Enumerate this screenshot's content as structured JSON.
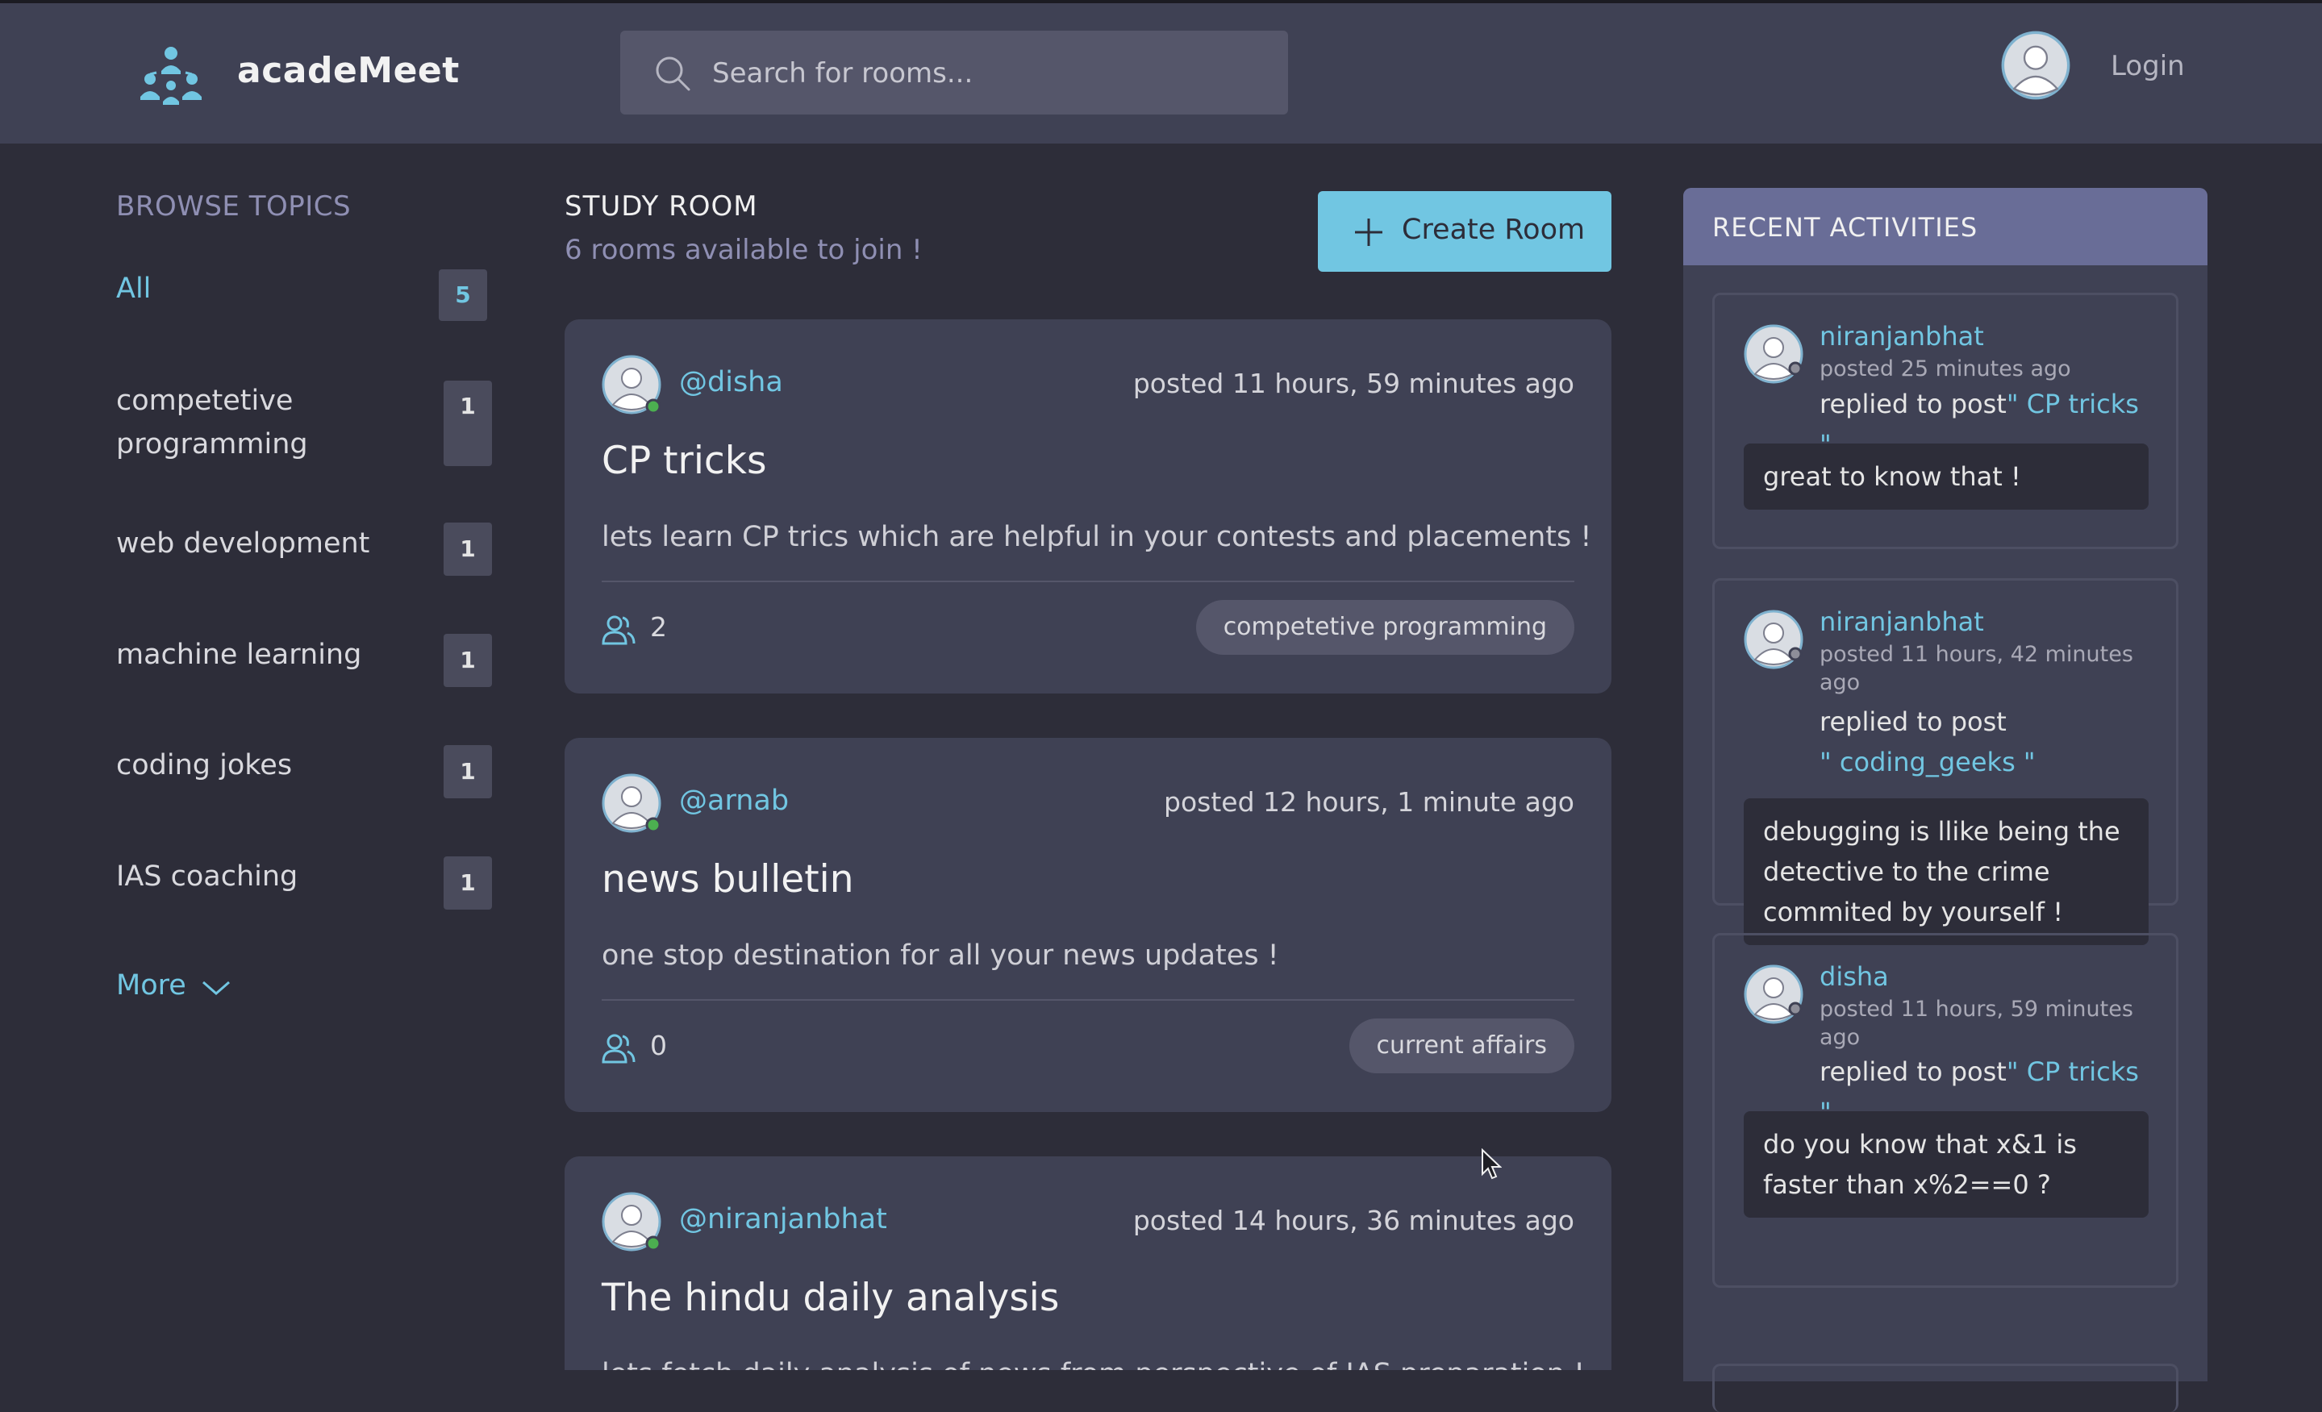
{
  "app": {
    "brand": "acadeMeet",
    "search_placeholder": "Search for rooms...",
    "login_label": "Login"
  },
  "sidebar": {
    "title": "BROWSE TOPICS",
    "topics": [
      {
        "label": "All",
        "count": "5"
      },
      {
        "label": "competetive programming",
        "count": "1"
      },
      {
        "label": "web development",
        "count": "1"
      },
      {
        "label": "machine learning",
        "count": "1"
      },
      {
        "label": "coding jokes",
        "count": "1"
      },
      {
        "label": "IAS coaching",
        "count": "1"
      }
    ],
    "more_label": "More"
  },
  "feed": {
    "title": "STUDY ROOM",
    "subtitle": "6 rooms available to join !",
    "create_label": "Create Room",
    "rooms": [
      {
        "host": "@disha",
        "posted": "posted 11 hours, 59 minutes ago",
        "title": "CP tricks",
        "description": "lets learn CP trics which are helpful in your contests and placements !",
        "participants": "2",
        "topic": "competetive programming"
      },
      {
        "host": "@arnab",
        "posted": "posted 12 hours, 1 minute ago",
        "title": "news bulletin",
        "description": "one stop destination for all your news updates !",
        "participants": "0",
        "topic": "current affairs"
      },
      {
        "host": "@niranjanbhat",
        "posted": "posted 14 hours, 36 minutes ago",
        "title": "The hindu daily analysis",
        "description": "lets fetch daily analysis of news from perspective of IAS preparation !",
        "participants": "",
        "topic": ""
      }
    ]
  },
  "activities": {
    "title": "RECENT ACTIVITIES",
    "items": [
      {
        "user": "niranjanbhat",
        "posted": "posted 25 minutes ago",
        "action": "replied to post",
        "post": "\" CP tricks \"",
        "message": "great to know that !"
      },
      {
        "user": "niranjanbhat",
        "posted": "posted 11 hours, 42 minutes ago",
        "action": "replied to post",
        "post": "\" coding_geeks \"",
        "message": "debugging is llike being the detective to the crime commited by yourself !"
      },
      {
        "user": "disha",
        "posted": "posted 11 hours, 59 minutes ago",
        "action": "replied to post",
        "post": "\" CP tricks \"",
        "message": "do you know that x&1 is faster than x%2==0 ?"
      }
    ]
  },
  "colors": {
    "background": "#2d2d39",
    "surface": "#3f4154",
    "accent": "#71c6e2",
    "muted_accent": "#8f8fb3",
    "activity_header": "#696d97"
  }
}
